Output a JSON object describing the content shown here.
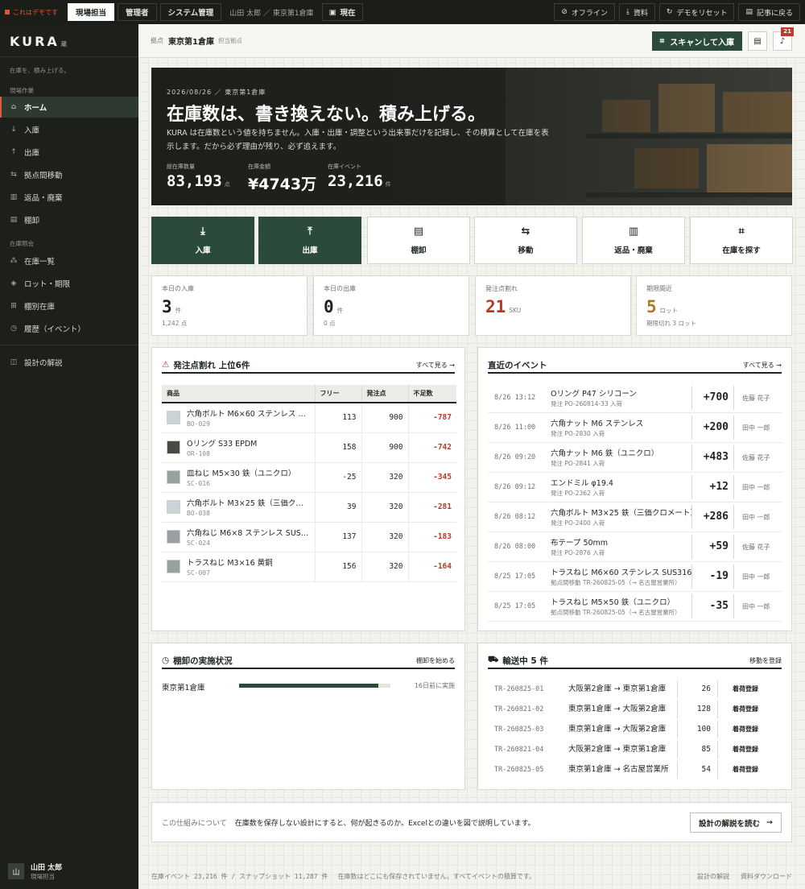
{
  "topbar": {
    "demo_label": "これはデモです",
    "roles": [
      "現場担当",
      "管理者",
      "システム管理"
    ],
    "user_context": "山田 太郎 ／ 東京第1倉庫",
    "now_label": "現在",
    "right_buttons": [
      "オフライン",
      "資料",
      "デモをリセット",
      "記事に戻る"
    ]
  },
  "sidebar": {
    "logo": "KURA",
    "logo_mark": "蔵",
    "tagline": "在庫を、積み上げる。",
    "section_work": "現場作業",
    "work_items": [
      {
        "label": "ホーム",
        "icon": "warehouse-icon"
      },
      {
        "label": "入庫",
        "icon": "arrow-down-icon"
      },
      {
        "label": "出庫",
        "icon": "arrow-up-icon"
      },
      {
        "label": "拠点間移動",
        "icon": "swap-icon"
      },
      {
        "label": "返品・廃棄",
        "icon": "trash-icon"
      },
      {
        "label": "棚卸",
        "icon": "clipboard-icon"
      }
    ],
    "section_query": "在庫照会",
    "query_items": [
      {
        "label": "在庫一覧",
        "icon": "boxes-icon"
      },
      {
        "label": "ロット・期限",
        "icon": "layers-icon"
      },
      {
        "label": "棚別在庫",
        "icon": "grid-icon"
      },
      {
        "label": "履歴（イベント）",
        "icon": "history-icon"
      }
    ],
    "design_item": {
      "label": "設計の解説",
      "icon": "layout-icon"
    },
    "user": {
      "avatar": "山",
      "name": "山田 太郎",
      "role": "現場担当"
    }
  },
  "header": {
    "site_label": "拠点",
    "site_name": "東京第1倉庫",
    "site_sub": "担当拠点",
    "scan_label": "スキャンして入庫",
    "notification_count": "21"
  },
  "hero": {
    "date": "2026/08/26 ／ 東京第1倉庫",
    "title": "在庫数は、書き換えない。積み上げる。",
    "description": "KURA は在庫数という値を持ちません。入庫・出庫・調整という出来事だけを記録し、その積算として在庫を表示します。だから必ず理由が残り、必ず追えます。",
    "stats": [
      {
        "label": "総在庫数量",
        "value": "83,193",
        "unit": "点"
      },
      {
        "label": "在庫金額",
        "value": "¥4743万",
        "unit": ""
      },
      {
        "label": "在庫イベント",
        "value": "23,216",
        "unit": "件"
      }
    ]
  },
  "actions": [
    {
      "label": "入庫",
      "icon": "arrow-down-icon",
      "dark": true
    },
    {
      "label": "出庫",
      "icon": "arrow-up-icon",
      "dark": true
    },
    {
      "label": "棚卸",
      "icon": "clipboard-icon",
      "dark": false
    },
    {
      "label": "移動",
      "icon": "swap-icon",
      "dark": false
    },
    {
      "label": "返品・廃棄",
      "icon": "trash-icon",
      "dark": false
    },
    {
      "label": "在庫を探す",
      "icon": "scan-icon",
      "dark": false
    }
  ],
  "kpis": [
    {
      "label": "本日の入庫",
      "value": "3",
      "unit": "件",
      "sub": "1,242 点",
      "color": "#1e241f"
    },
    {
      "label": "本日の出庫",
      "value": "0",
      "unit": "件",
      "sub": "0 点",
      "color": "#1e241f"
    },
    {
      "label": "発注点割れ",
      "value": "21",
      "unit": "SKU",
      "sub": "",
      "color": "#b53a26"
    },
    {
      "label": "期限間近",
      "value": "5",
      "unit": "ロット",
      "sub": "期限切れ 3 ロット",
      "color": "#b0782a"
    }
  ],
  "reorder": {
    "title": "発注点割れ 上位6件",
    "link": "すべて見る",
    "columns": [
      "商品",
      "フリー",
      "発注点",
      "不足数"
    ],
    "rows": [
      {
        "name": "六角ボルト M6×60 ステンレス SUS304",
        "code": "BO-029",
        "free": "113",
        "reorder": "900",
        "short": "-787",
        "thumb": "#c9d3d8"
      },
      {
        "name": "Oリング S33 EPDM",
        "code": "OR-108",
        "free": "158",
        "reorder": "900",
        "short": "-742",
        "thumb": "#4a4a44"
      },
      {
        "name": "皿ねじ M5×30 鉄（ユニクロ）",
        "code": "SC-016",
        "free": "-25",
        "reorder": "320",
        "short": "-345",
        "thumb": "#9aa0a2"
      },
      {
        "name": "六角ボルト M3×25 鉄（三価クロメート）",
        "code": "BO-038",
        "free": "39",
        "reorder": "320",
        "short": "-281",
        "thumb": "#c9d3d8"
      },
      {
        "name": "六角ねじ M6×8 ステンレス SUS316",
        "code": "SC-024",
        "free": "137",
        "reorder": "320",
        "short": "-183",
        "thumb": "#9aa0a2"
      },
      {
        "name": "トラスねじ M3×16 黄銅",
        "code": "SC-007",
        "free": "156",
        "reorder": "320",
        "short": "-164",
        "thumb": "#9aa0a2"
      }
    ]
  },
  "events": {
    "title": "直近のイベント",
    "link": "すべて見る",
    "rows": [
      {
        "time": "8/26 13:12",
        "name": "Oリング P47 シリコーン",
        "sub": "発注 PO-260814-33 入荷",
        "qty": "+700",
        "user": "佐藤 花子"
      },
      {
        "time": "8/26 11:00",
        "name": "六角ナット M6 ステンレス",
        "sub": "発注 PO-2830 入荷",
        "qty": "+200",
        "user": "田中 一郎"
      },
      {
        "time": "8/26 09:20",
        "name": "六角ナット M6 鉄（ユニクロ）",
        "sub": "発注 PO-2841 入荷",
        "qty": "+483",
        "user": "佐藤 花子"
      },
      {
        "time": "8/26 09:12",
        "name": "エンドミル φ19.4",
        "sub": "発注 PO-2362 入荷",
        "qty": "+12",
        "user": "田中 一郎"
      },
      {
        "time": "8/26 08:12",
        "name": "六角ボルト M3×25 鉄（三価クロメート）",
        "sub": "発注 PO-2400 入荷",
        "qty": "+286",
        "user": "田中 一郎"
      },
      {
        "time": "8/26 08:00",
        "name": "布テープ 50mm",
        "sub": "発注 PO-2876 入荷",
        "qty": "+59",
        "user": "佐藤 花子"
      },
      {
        "time": "8/25 17:05",
        "name": "トラスねじ M6×60 ステンレス SUS316",
        "sub": "拠点間移動 TR-260825-05（→ 名古屋営業所）",
        "qty": "-19",
        "user": "田中 一郎"
      },
      {
        "time": "8/25 17:05",
        "name": "トラスねじ M5×50 鉄（ユニクロ）",
        "sub": "拠点間移動 TR-260825-05（→ 名古屋営業所）",
        "qty": "-35",
        "user": "田中 一郎"
      }
    ]
  },
  "stocktake": {
    "title": "棚卸の実施状況",
    "link": "棚卸を始める",
    "site": "東京第1倉庫",
    "progress": 0.92,
    "status": "16日前に実施"
  },
  "transit": {
    "title": "輸送中 5 件",
    "link": "移動を登録",
    "rows": [
      {
        "id": "TR-260825-01",
        "route": "大阪第2倉庫 → 東京第1倉庫",
        "qty": "26",
        "action": "着荷登録"
      },
      {
        "id": "TR-260821-02",
        "route": "東京第1倉庫 → 大阪第2倉庫",
        "qty": "128",
        "action": "着荷登録"
      },
      {
        "id": "TR-260825-03",
        "route": "東京第1倉庫 → 大阪第2倉庫",
        "qty": "100",
        "action": "着荷登録"
      },
      {
        "id": "TR-260821-04",
        "route": "大阪第2倉庫 → 東京第1倉庫",
        "qty": "85",
        "action": "着荷登録"
      },
      {
        "id": "TR-260825-05",
        "route": "東京第1倉庫 → 名古屋営業所",
        "qty": "54",
        "action": "着荷登録"
      }
    ]
  },
  "about": {
    "label": "この仕組みについて",
    "text": "在庫数を保存しない設計にすると、何が起きるのか。Excelとの違いを図で説明しています。",
    "button": "設計の解説を読む"
  },
  "footer": {
    "counts": "在庫イベント 23,216 件 / スナップショット 11,287 件",
    "note": "在庫数はどこにも保存されていません。すべてイベントの積算です。",
    "links": [
      "設計の解説",
      "資料ダウンロード"
    ]
  }
}
